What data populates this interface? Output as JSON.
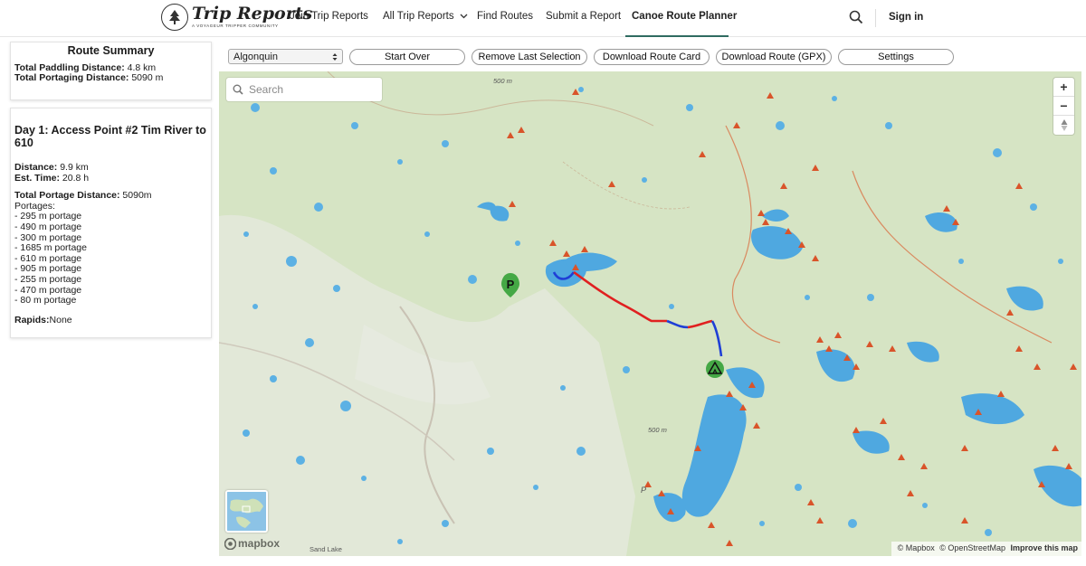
{
  "nav": {
    "logo_title": "Trip Reports",
    "logo_subtitle": "A VOYAGEUR TRIPPER COMMUNITY",
    "items": [
      {
        "label": "Join Trip Reports"
      },
      {
        "label": "All Trip Reports"
      },
      {
        "label": "Find Routes"
      },
      {
        "label": "Submit a Report"
      },
      {
        "label": "Canoe Route Planner"
      }
    ],
    "sign_in": "Sign in"
  },
  "summary": {
    "title": "Route Summary",
    "paddling_label": "Total Paddling Distance:",
    "paddling_value": "4.8 km",
    "portaging_label": "Total Portaging Distance:",
    "portaging_value": "5090 m"
  },
  "day": {
    "title": "Day 1: Access Point #2 Tim River to 610",
    "distance_label": "Distance:",
    "distance_value": "9.9 km",
    "time_label": "Est. Time:",
    "time_value": "20.8 h",
    "portage_total_label": "Total Portage Distance:",
    "portage_total_value": "5090m",
    "portages_label": "Portages:",
    "portages": [
      "- 295 m portage",
      "- 490 m portage",
      "- 300 m portage",
      "- 1685 m portage",
      "- 610 m portage",
      "- 905 m portage",
      "- 255 m portage",
      "- 470 m portage",
      "- 80 m portage"
    ],
    "rapids_label": "Rapids:",
    "rapids_value": "None"
  },
  "toolbar": {
    "park_select": "Algonquin",
    "buttons": [
      "Start Over",
      "Remove Last Selection",
      "Download Route Card",
      "Download Route (GPX)",
      "Settings"
    ]
  },
  "map": {
    "search_placeholder": "Search",
    "zoom_in": "+",
    "zoom_out": "−",
    "attribution": [
      "© Mapbox",
      "© OpenStreetMap",
      "Improve this map"
    ],
    "mapbox_logo": "mapbox",
    "labels": [
      "500 m",
      "500 m",
      "Sand Lake",
      "P"
    ],
    "colors": {
      "land": "#d6e4c4",
      "water": "#4fa8e0",
      "portage": "#e02020",
      "paddle": "#1f3fd6",
      "campsite": "#d9542a",
      "marker": "#45a845"
    }
  }
}
